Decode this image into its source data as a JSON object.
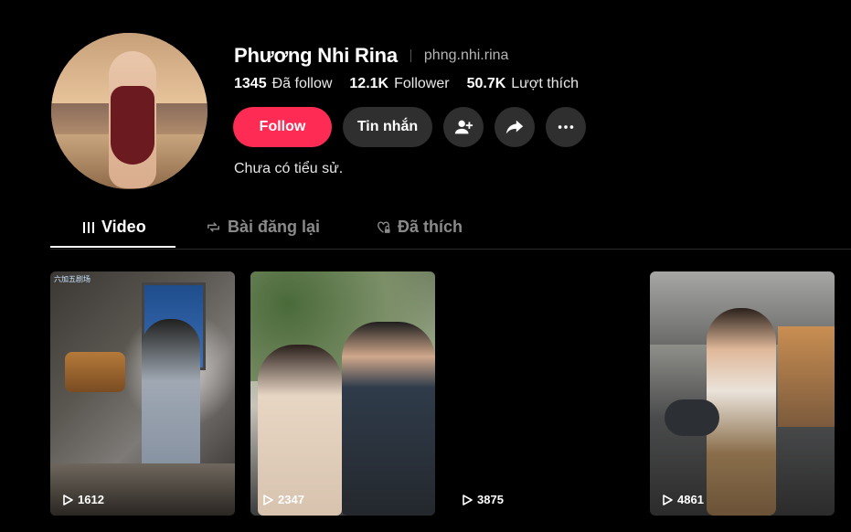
{
  "profile": {
    "display_name": "Phương Nhi Rina",
    "handle": "phng.nhi.rina",
    "bio": "Chưa có tiểu sử."
  },
  "stats": [
    {
      "value": "1345",
      "label": "Đã follow"
    },
    {
      "value": "12.1K",
      "label": "Follower"
    },
    {
      "value": "50.7K",
      "label": "Lượt thích"
    }
  ],
  "actions": {
    "follow_label": "Follow",
    "message_label": "Tin nhắn",
    "add_friend_icon": "add-user-icon",
    "share_icon": "share-icon",
    "more_icon": "more-icon"
  },
  "tabs": [
    {
      "label": "Video",
      "icon": "grid-icon",
      "active": true
    },
    {
      "label": "Bài đăng lại",
      "icon": "repost-icon",
      "active": false
    },
    {
      "label": "Đã thích",
      "icon": "heart-lock-icon",
      "active": false
    }
  ],
  "videos": [
    {
      "views": "1612",
      "watermark": "六加五剧场"
    },
    {
      "views": "2347"
    },
    {
      "views": "3875"
    },
    {
      "views": "4861"
    }
  ],
  "colors": {
    "accent": "#fe2c55",
    "background": "#000000",
    "button": "#2f2f2f"
  }
}
